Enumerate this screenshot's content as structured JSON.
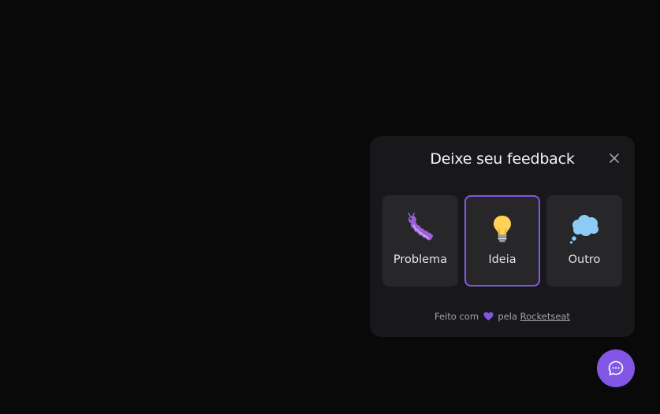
{
  "widget": {
    "title": "Deixe seu feedback",
    "options": [
      {
        "label": "Problema",
        "icon": "bug-icon",
        "selected": false
      },
      {
        "label": "Ideia",
        "icon": "lightbulb-icon",
        "selected": true
      },
      {
        "label": "Outro",
        "icon": "thought-balloon-icon",
        "selected": false
      }
    ],
    "footer": {
      "prefix": "Feito com",
      "middle": "pela",
      "link": "Rocketseat"
    }
  },
  "colors": {
    "background": "#09090a",
    "surface": "#18181b",
    "card": "#27272a",
    "accent": "#8257e5",
    "text": "#f4f4f5",
    "muted": "#a1a1aa"
  }
}
